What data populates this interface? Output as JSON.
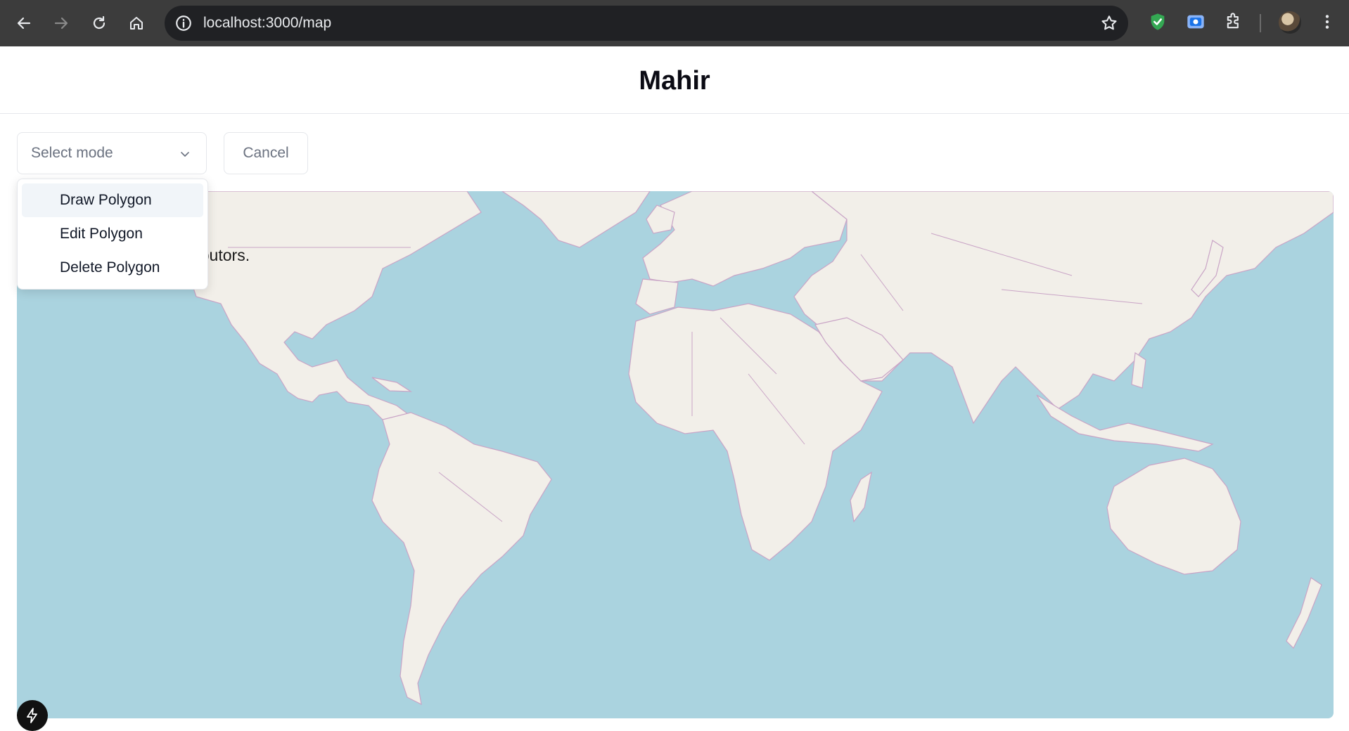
{
  "browser": {
    "url": "localhost:3000/map",
    "colors": {
      "chrome": "#3c3c3c",
      "urlbar": "#202124",
      "shield": "#34a853"
    }
  },
  "app": {
    "title": "Mahir"
  },
  "controls": {
    "select_placeholder": "Select mode",
    "cancel_label": "Cancel"
  },
  "dropdown": {
    "items": [
      {
        "label": "Draw Polygon",
        "active": true
      },
      {
        "label": "Edit Polygon",
        "active": false
      },
      {
        "label": "Delete Polygon",
        "active": false
      }
    ]
  },
  "map": {
    "attribution_visible": "ributors.",
    "colors": {
      "water": "#aad3df",
      "land": "#f2efe9",
      "borders": "#c9a4c6"
    }
  },
  "icons": {
    "back": "arrow-left-icon",
    "forward": "arrow-right-icon",
    "reload": "reload-icon",
    "home": "home-icon",
    "info": "info-icon",
    "star": "star-icon",
    "extension_shield": "shield-icon",
    "extension_screen": "screenshot-icon",
    "extensions": "puzzle-icon",
    "menu": "kebab-menu-icon",
    "select_chevron": "chevron-down-icon",
    "devtools": "bolt-icon"
  }
}
